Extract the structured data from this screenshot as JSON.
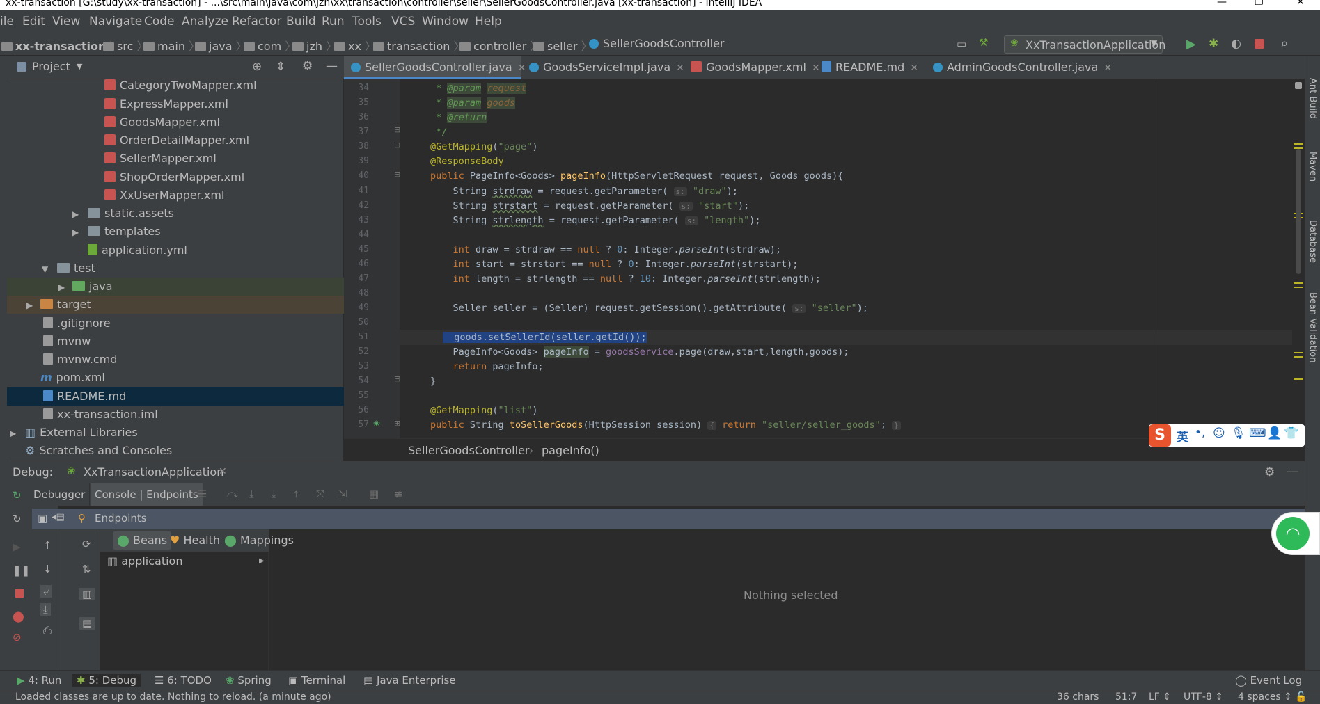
{
  "window": {
    "title": "xx-transaction [G:\\study\\xx-transaction] - ...\\src\\main\\java\\com\\jzh\\xx\\transaction\\controller\\seller\\SellerGoodsController.java [xx-transaction] - IntelliJ IDEA"
  },
  "menu": [
    "ile",
    "Edit",
    "View",
    "Navigate",
    "Code",
    "Analyze",
    "Refactor",
    "Build",
    "Run",
    "Tools",
    "VCS",
    "Window",
    "Help"
  ],
  "nav": {
    "crumbs": [
      "xx-transaction",
      "src",
      "main",
      "java",
      "com",
      "jzh",
      "xx",
      "transaction",
      "controller",
      "seller",
      "SellerGoodsController"
    ],
    "run_config": "XxTransactionApplication"
  },
  "project": {
    "header": "Project",
    "items": [
      "CategoryTwoMapper.xml",
      "ExpressMapper.xml",
      "GoodsMapper.xml",
      "OrderDetailMapper.xml",
      "SellerMapper.xml",
      "ShopOrderMapper.xml",
      "XxUserMapper.xml",
      "static.assets",
      "templates",
      "application.yml",
      "test",
      "java",
      "target",
      ".gitignore",
      "mvnw",
      "mvnw.cmd",
      "pom.xml",
      "README.md",
      "xx-transaction.iml",
      "External Libraries",
      "Scratches and Consoles"
    ]
  },
  "tabs": [
    "SellerGoodsController.java",
    "GoodsServiceImpl.java",
    "GoodsMapper.xml",
    "README.md",
    "AdminGoodsController.java"
  ],
  "editor": {
    "line_numbers": [
      "34",
      "35",
      "36",
      "37",
      "38",
      "39",
      "40",
      "41",
      "42",
      "43",
      "44",
      "45",
      "46",
      "47",
      "48",
      "49",
      "50",
      "51",
      "52",
      "53",
      "54",
      "55",
      "56",
      "57"
    ],
    "breadcrumb": [
      "SellerGoodsController",
      "pageInfo()"
    ]
  },
  "debug": {
    "label": "Debug:",
    "config": "XxTransactionApplication",
    "tabs": [
      "Debugger",
      "Console | Endpoints"
    ],
    "endpoints_label": "Endpoints",
    "sub_tabs": [
      "Beans",
      "Health",
      "Mappings"
    ],
    "tree_item": "application",
    "nothing_selected": "Nothing selected"
  },
  "right_tools": [
    "Ant Build",
    "Maven",
    "Database",
    "Bean Validation"
  ],
  "tool_windows": [
    "4: Run",
    "5: Debug",
    "6: TODO",
    "Spring",
    "Terminal",
    "Java Enterprise",
    "Event Log"
  ],
  "status": {
    "message": "Loaded classes are up to date. Nothing to reload. (a minute ago)",
    "chars": "36 chars",
    "position": "51:7",
    "line_sep": "LF",
    "encoding": "UTF-8",
    "indent": "4 spaces"
  },
  "ime": {
    "lang": "英"
  },
  "colors": {
    "selection": "#214283",
    "accent": "#4a88c7",
    "background": "#2b2b2b"
  }
}
